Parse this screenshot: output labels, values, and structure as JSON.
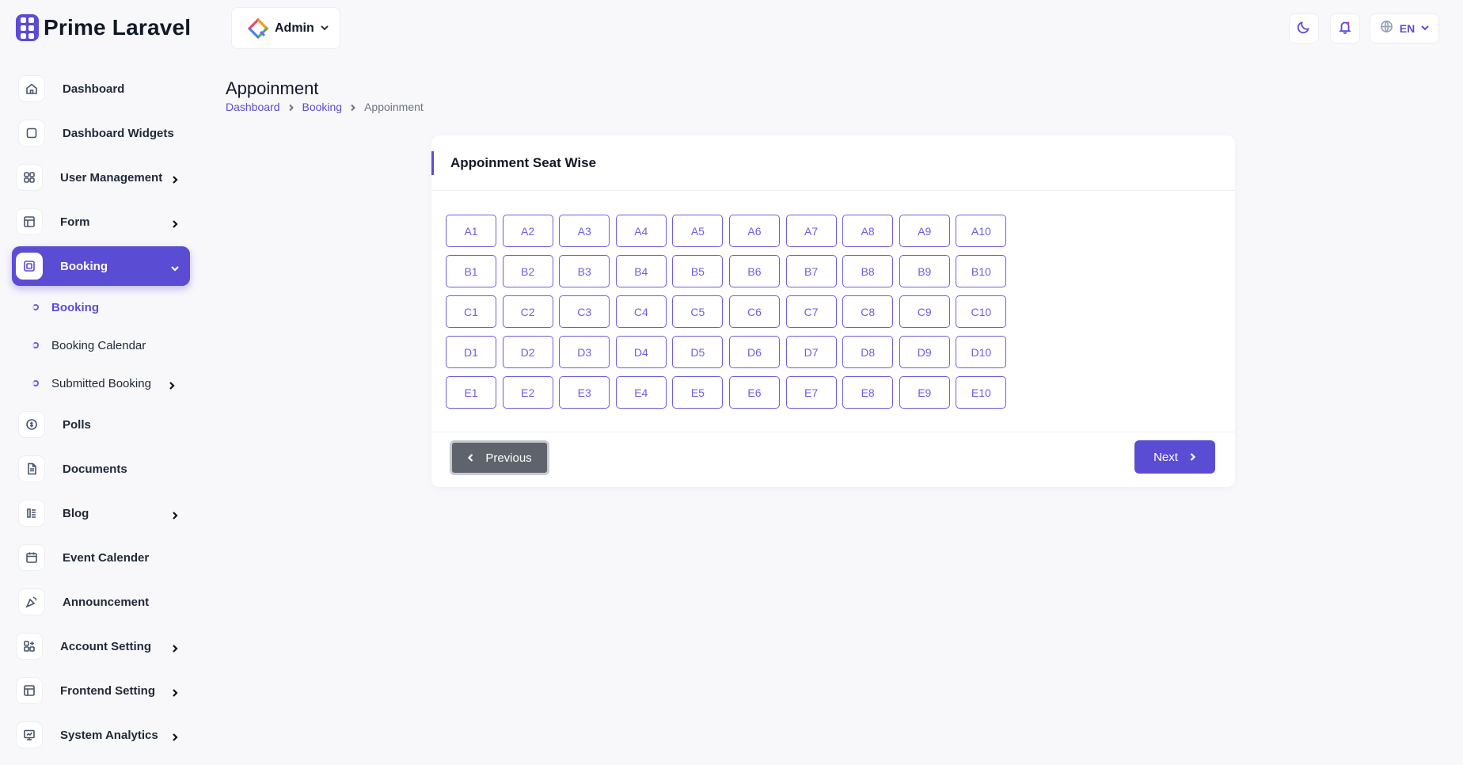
{
  "brand": {
    "name": "Prime Laravel",
    "accent": "#5b4cd4"
  },
  "header": {
    "switcher_label": "Admin",
    "language": "EN"
  },
  "sidebar": {
    "items": [
      {
        "label": "Dashboard",
        "icon": "home-icon"
      },
      {
        "label": "Dashboard Widgets",
        "icon": "square-icon"
      },
      {
        "label": "User Management",
        "icon": "apps-icon"
      },
      {
        "label": "Form",
        "icon": "table-icon"
      },
      {
        "label": "Booking",
        "icon": "booking-icon"
      },
      {
        "label": "Polls",
        "icon": "poll-icon"
      },
      {
        "label": "Documents",
        "icon": "document-icon"
      },
      {
        "label": "Blog",
        "icon": "blog-icon"
      },
      {
        "label": "Event Calender",
        "icon": "calendar-icon"
      },
      {
        "label": "Announcement",
        "icon": "announcement-icon"
      },
      {
        "label": "Account Setting",
        "icon": "account-icon"
      },
      {
        "label": "Frontend Setting",
        "icon": "layout-icon"
      },
      {
        "label": "System Analytics",
        "icon": "analytics-icon"
      }
    ],
    "booking_sub": [
      {
        "label": "Booking"
      },
      {
        "label": "Booking Calendar"
      },
      {
        "label": "Submitted Booking"
      }
    ]
  },
  "page": {
    "title": "Appoinment",
    "breadcrumb": [
      "Dashboard",
      "Booking",
      "Appoinment"
    ]
  },
  "card": {
    "title": "Appoinment Seat Wise",
    "seats": [
      [
        "A1",
        "A2",
        "A3",
        "A4",
        "A5",
        "A6",
        "A7",
        "A8",
        "A9",
        "A10"
      ],
      [
        "B1",
        "B2",
        "B3",
        "B4",
        "B5",
        "B6",
        "B7",
        "B8",
        "B9",
        "B10"
      ],
      [
        "C1",
        "C2",
        "C3",
        "C4",
        "C5",
        "C6",
        "C7",
        "C8",
        "C9",
        "C10"
      ],
      [
        "D1",
        "D2",
        "D3",
        "D4",
        "D5",
        "D6",
        "D7",
        "D8",
        "D9",
        "D10"
      ],
      [
        "E1",
        "E2",
        "E3",
        "E4",
        "E5",
        "E6",
        "E7",
        "E8",
        "E9",
        "E10"
      ]
    ],
    "prev_label": "Previous",
    "next_label": "Next"
  }
}
